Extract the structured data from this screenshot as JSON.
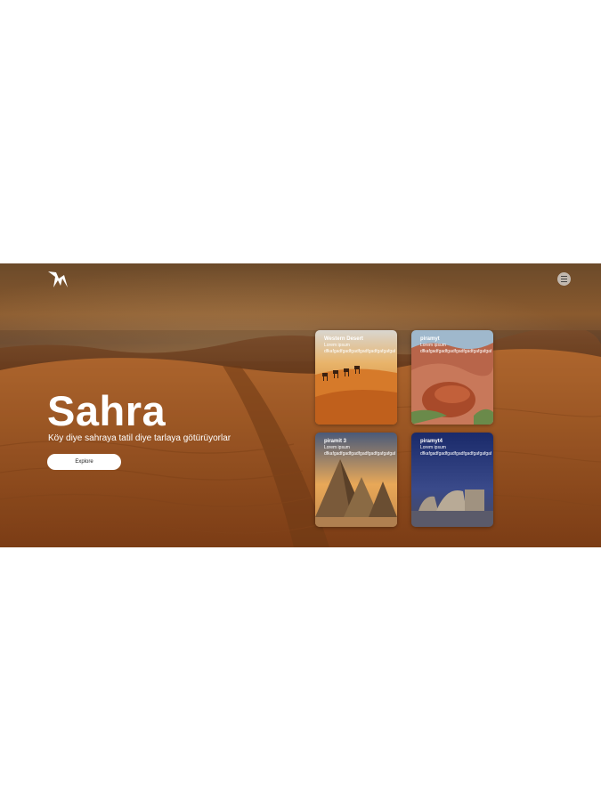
{
  "hero": {
    "title": "Sahra",
    "subtitle": "Köy diye sahraya tatil diye tarlaya götürüyorlar",
    "explore_label": "Explore",
    "menu_icon": "menu-icon",
    "logo_icon": "bird-logo-icon"
  },
  "cards": [
    {
      "title": "Western Desert",
      "subtitle": "Lorem ipsum",
      "desc": "dfkafgadfgadfgadfgadfgadfgafgafgafg",
      "theme": "camels-desert"
    },
    {
      "title": "piramyt",
      "subtitle": "Lorem ipsum",
      "desc": "dfkafgadfgadfgadfgadfgadfgafgafgafg",
      "theme": "red-rocks"
    },
    {
      "title": "piramit 3",
      "subtitle": "Lorem ipsum",
      "desc": "dfkafgadfgadfgadfgadfgadfgafgafgafg",
      "theme": "pyramids"
    },
    {
      "title": "piramyt4",
      "subtitle": "Lorem ipsum",
      "desc": "dfkafgadfgadfgadfgadfgadfgafgafgafg",
      "theme": "night-ruins"
    }
  ],
  "colors": {
    "sand": "#b9692a",
    "sky": "#6b4a2a",
    "button_bg": "#ffffff"
  }
}
